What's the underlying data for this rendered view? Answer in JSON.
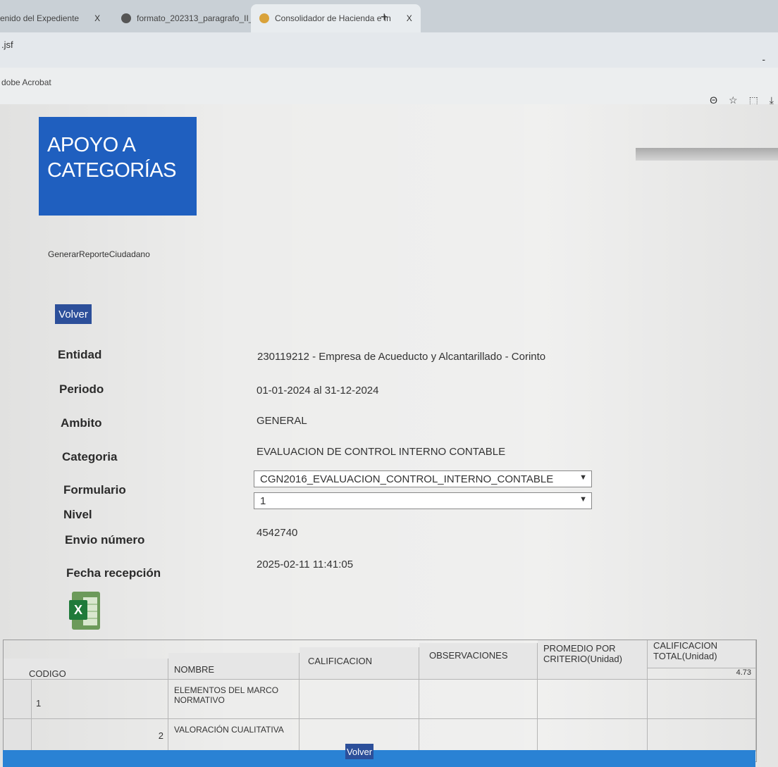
{
  "browser": {
    "tabs": [
      {
        "label": "enido del Expediente",
        "close": "X"
      },
      {
        "label": "formato_202313_paragrafo_II_",
        "close": "X"
      },
      {
        "label": "Consolidador de Hacienda e In",
        "close": "X"
      }
    ],
    "new_tab": "+",
    "url": ".jsf",
    "bookmark": "dobe Acrobat",
    "minimize": "-",
    "toolbar_icons": [
      "Θ",
      "☆",
      "⬚",
      "⤓"
    ]
  },
  "page": {
    "logo_line1": "APOYO A",
    "logo_line2": "CATEGORÍAS",
    "report_link": "GenerarReporteCiudadano",
    "back_button": "Volver",
    "fields": [
      {
        "label": "Entidad",
        "value": "230119212 - Empresa de Acueducto y Alcantarillado - Corinto"
      },
      {
        "label": "Periodo",
        "value": "01-01-2024 al 31-12-2024"
      },
      {
        "label": "Ambito",
        "value": "GENERAL"
      },
      {
        "label": "Categoria",
        "value": "EVALUACION DE CONTROL INTERNO CONTABLE"
      }
    ],
    "formulario_label": "Formulario",
    "formulario_value": "CGN2016_EVALUACION_CONTROL_INTERNO_CONTABLE",
    "nivel_label": "Nivel",
    "nivel_value": "1",
    "envio_label": "Envio número",
    "envio_value": "4542740",
    "fecha_label": "Fecha recepción",
    "fecha_value": "2025-02-11 11:41:05",
    "excel_icon": "excel-export-icon",
    "table": {
      "headers": [
        "CODIGO",
        "NOMBRE",
        "CALIFICACION",
        "OBSERVACIONES",
        "PROMEDIO POR CRITERIO(Unidad)",
        "CALIFICACION TOTAL(Unidad)"
      ],
      "total_value": "4.73",
      "rows": [
        {
          "codigo": "1",
          "nombre": "ELEMENTOS DEL MARCO NORMATIVO"
        },
        {
          "codigo": "2",
          "nombre": "VALORACIÓN CUALITATIVA"
        }
      ]
    },
    "bottom_button": "Volver"
  }
}
